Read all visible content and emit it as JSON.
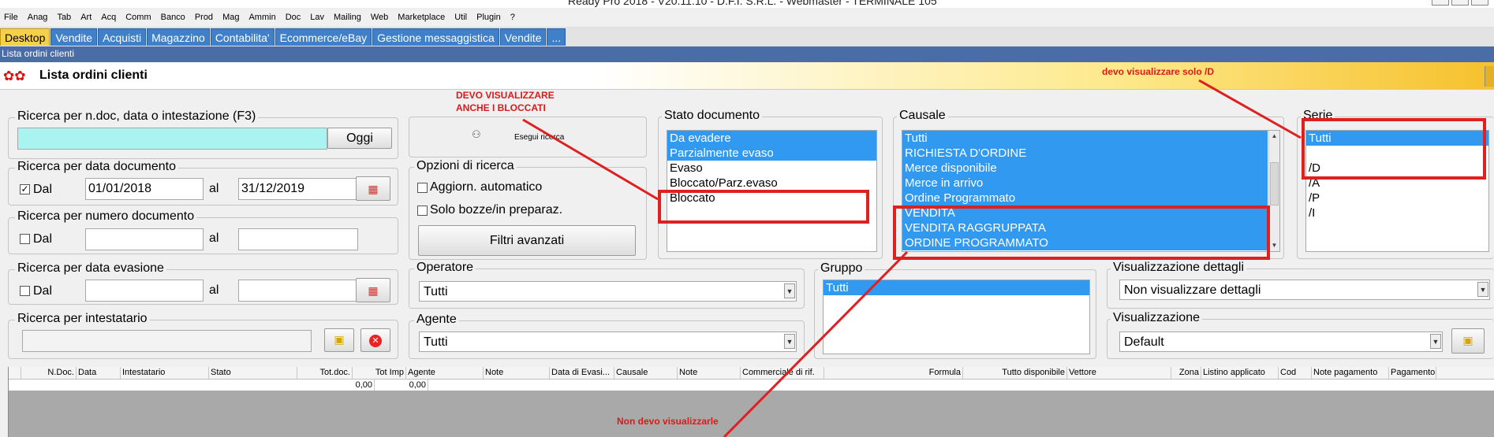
{
  "window": {
    "title": "Ready Pro 2018 - V20.11.10 - D.F.I. S.R.L. - Webmaster - TERMINALE 105"
  },
  "menu": [
    "File",
    "Anag",
    "Tab",
    "Art",
    "Acq",
    "Comm",
    "Banco",
    "Prod",
    "Mag",
    "Ammin",
    "Doc",
    "Lav",
    "Mailing",
    "Web",
    "Marketplace",
    "Util",
    "Plugin",
    "?"
  ],
  "tabs": [
    "Desktop",
    "Vendite",
    "Acquisti",
    "Magazzino",
    "Contabilita'",
    "Ecommerce/eBay",
    "Gestione messaggistica",
    "Vendite",
    "..."
  ],
  "subtitle": "Lista ordini clienti",
  "header": {
    "title": "Lista ordini clienti"
  },
  "search": {
    "label": "Ricerca per n.doc, data o intestazione (F3)",
    "value": "",
    "today_label": "Oggi",
    "run_label": "Esegui ricerca"
  },
  "date_doc": {
    "label": "Ricerca per data documento",
    "dal": "Dal",
    "from": "01/01/2018",
    "al": "al",
    "to": "31/12/2019",
    "checked": "✓"
  },
  "num_doc": {
    "label": "Ricerca per numero documento",
    "dal": "Dal",
    "al": "al"
  },
  "date_eva": {
    "label": "Ricerca per data evasione",
    "dal": "Dal",
    "al": "al"
  },
  "holder": {
    "label": "Ricerca per intestatario"
  },
  "options": {
    "label": "Opzioni di ricerca",
    "auto": "Aggiorn. automatico",
    "drafts": "Solo bozze/in preparaz.",
    "advanced": "Filtri avanzati"
  },
  "operator": {
    "label": "Operatore",
    "value": "Tutti"
  },
  "agent": {
    "label": "Agente",
    "value": "Tutti"
  },
  "status": {
    "label": "Stato documento",
    "items": [
      {
        "label": "Da evadere",
        "selected": true
      },
      {
        "label": "Parzialmente evaso",
        "selected": true
      },
      {
        "label": "Evaso",
        "selected": false
      },
      {
        "label": "Bloccato/Parz.evaso",
        "selected": false
      },
      {
        "label": "Bloccato",
        "selected": false
      }
    ]
  },
  "causale": {
    "label": "Causale",
    "items": [
      {
        "label": "Tutti",
        "selected": true
      },
      {
        "label": "RICHIESTA D'ORDINE",
        "selected": true
      },
      {
        "label": "Merce disponibile",
        "selected": true
      },
      {
        "label": "Merce in arrivo",
        "selected": true
      },
      {
        "label": "Ordine Programmato",
        "selected": true
      },
      {
        "label": "VENDITA",
        "selected": true
      },
      {
        "label": "VENDITA RAGGRUPPATA",
        "selected": true
      },
      {
        "label": "ORDINE PROGRAMMATO",
        "selected": true
      }
    ]
  },
  "serie": {
    "label": "Serie",
    "items": [
      {
        "label": "Tutti",
        "selected": true
      },
      {
        "label": "",
        "selected": false
      },
      {
        "label": "/D",
        "selected": false
      },
      {
        "label": "/A",
        "selected": false
      },
      {
        "label": "/P",
        "selected": false
      },
      {
        "label": "/I",
        "selected": false
      }
    ]
  },
  "gruppo": {
    "label": "Gruppo",
    "items": [
      {
        "label": "Tutti",
        "selected": true
      }
    ]
  },
  "details": {
    "label": "Visualizzazione dettagli",
    "value": "Non visualizzare dettagli"
  },
  "view": {
    "label": "Visualizzazione",
    "value": "Default"
  },
  "annotations": {
    "blocked": "DEVO VISUALIZZARE\nANCHE I BLOCCATI",
    "serie": "devo visualizzare solo /D",
    "causale": "Non devo visualizzarle"
  },
  "grid": {
    "columns": [
      "",
      "N.Doc.",
      "Data",
      "Intestatario",
      "Stato",
      "Tot.doc.",
      "Tot Imp",
      "Agente",
      "Note",
      "Data di Evasi...",
      "Causale",
      "Note",
      "Commerciale di rif.",
      "Formula",
      "Tutto disponibile",
      "Vettore",
      "Zona",
      "Listino applicato",
      "Cod",
      "Note pagamento",
      "Pagamento"
    ],
    "totals": {
      "totdoc": "0,00",
      "totimp": "0,00"
    }
  },
  "colors": {
    "accent": "#3199f0",
    "annotation": "#de2020",
    "tab": "#3f80c9",
    "tab_active": "#f5d14b"
  }
}
